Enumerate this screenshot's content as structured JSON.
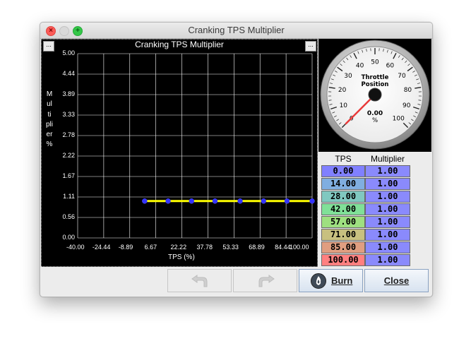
{
  "window": {
    "title": "Cranking TPS Multiplier"
  },
  "chart": {
    "title": "Cranking TPS Multiplier",
    "menu_left": "...",
    "menu_right": "...",
    "xlabel": "TPS (%)",
    "ylabel": "Multiplier %"
  },
  "chart_data": {
    "type": "line",
    "title": "Cranking TPS Multiplier",
    "xlabel": "TPS (%)",
    "ylabel": "Multiplier %",
    "x_ticks": [
      "-40.00",
      "-24.44",
      "-8.89",
      "6.67",
      "22.22",
      "37.78",
      "53.33",
      "68.89",
      "84.44",
      "100.00"
    ],
    "y_ticks": [
      "5.00",
      "4.44",
      "3.89",
      "3.33",
      "2.78",
      "2.22",
      "1.67",
      "1.11",
      "0.56",
      "0.00"
    ],
    "xlim": [
      -40,
      100
    ],
    "ylim": [
      0,
      5
    ],
    "grid": true,
    "series": [
      {
        "x": [
          0,
          14,
          28,
          42,
          57,
          71,
          85,
          100
        ],
        "y": [
          1.0,
          1.0,
          1.0,
          1.0,
          1.0,
          1.0,
          1.0,
          1.0
        ]
      }
    ],
    "line_color": "#ffff00",
    "point_color": "#3333ff"
  },
  "gauge": {
    "title_line1": "Throttle",
    "title_line2": "Position",
    "value": "0.00",
    "unit": "%",
    "reading": 0,
    "min": 0,
    "max": 100,
    "labels": [
      "0",
      "10",
      "20",
      "30",
      "40",
      "50",
      "60",
      "70",
      "80",
      "90",
      "100"
    ]
  },
  "table": {
    "col_tps": "TPS",
    "col_mult": "Multiplier",
    "rows": [
      {
        "tps": "0.00",
        "mult": "1.00",
        "color": "#8080ff"
      },
      {
        "tps": "14.00",
        "mult": "1.00",
        "color": "#80aee0"
      },
      {
        "tps": "28.00",
        "mult": "1.00",
        "color": "#80c8c0"
      },
      {
        "tps": "42.00",
        "mult": "1.00",
        "color": "#80e098"
      },
      {
        "tps": "57.00",
        "mult": "1.00",
        "color": "#9ee080"
      },
      {
        "tps": "71.00",
        "mult": "1.00",
        "color": "#c8c080"
      },
      {
        "tps": "85.00",
        "mult": "1.00",
        "color": "#e09e80"
      },
      {
        "tps": "100.00",
        "mult": "1.00",
        "color": "#ff8080"
      }
    ]
  },
  "buttons": {
    "undo_icon": "undo-arrow-icon",
    "redo_icon": "redo-arrow-icon",
    "burn_label": "Burn",
    "close_label": "Close",
    "burn_icon": "flame-icon"
  }
}
